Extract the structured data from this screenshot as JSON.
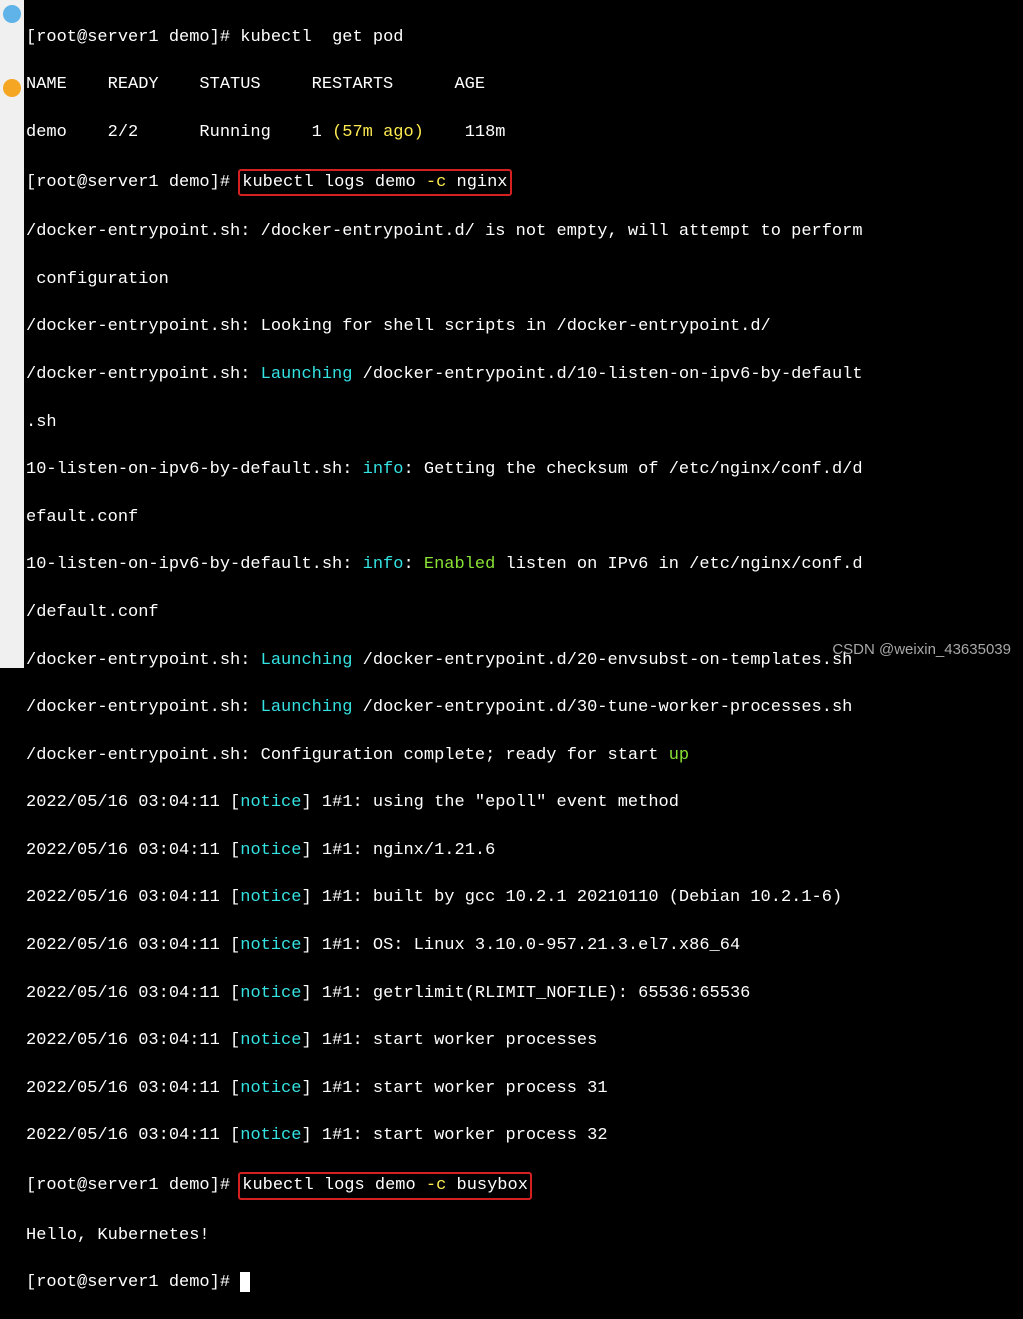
{
  "leftbar": {
    "icons": [
      "plane-icon",
      "orange-icon"
    ]
  },
  "prompts": {
    "p1": "[root@server1 demo]# ",
    "cmd1": "kubectl  get pod",
    "cmd2": "kubectl logs demo ",
    "flag_c": "-c",
    "ctn_nginx": " nginx",
    "ctn_busybox": " busybox"
  },
  "pod_header": "NAME    READY    STATUS     RESTARTS      AGE",
  "pod_row": "demo    2/2      Running    1 ",
  "pod_restart_age": "(57m ago)",
  "pod_age": "    118m",
  "logs": {
    "l1": "/docker-entrypoint.sh: /docker-entrypoint.d/ is not empty, will attempt to perform",
    "l2": " configuration",
    "l3": "/docker-entrypoint.sh: Looking for shell scripts in /docker-entrypoint.d/",
    "l4a": "/docker-entrypoint.sh: ",
    "launching": "Launching",
    "l4b": " /docker-entrypoint.d/10-listen-on-ipv6-by-default",
    "l5": ".sh",
    "l6a": "10-listen-on-ipv6-by-default.sh: ",
    "info": "info",
    "l6b": ": Getting the checksum of /etc/nginx/conf.d/d",
    "l7": "efault.conf",
    "l8b": ": ",
    "enabled": "Enabled",
    "l8c": " listen on IPv6 in /etc/nginx/conf.d",
    "l9": "/default.conf",
    "l10b": " /docker-entrypoint.d/20-envsubst-on-templates.sh",
    "l11b": " /docker-entrypoint.d/30-tune-worker-processes.sh",
    "l12a": "/docker-entrypoint.sh: Configuration complete; ready for start ",
    "up": "up",
    "ts": "2022/05/16 03:04:11 [",
    "notice": "notice",
    "nl1": "] 1#1: using the \"epoll\" event method",
    "nl2": "] 1#1: nginx/1.21.6",
    "nl3": "] 1#1: built by gcc 10.2.1 20210110 (Debian 10.2.1-6)",
    "nl4": "] 1#1: OS: Linux 3.10.0-957.21.3.el7.x86_64",
    "nl5": "] 1#1: getrlimit(RLIMIT_NOFILE): 65536:65536",
    "nl6": "] 1#1: start worker processes",
    "nl7": "] 1#1: start worker process 31",
    "nl8": "] 1#1: start worker process 32",
    "hello": "Hello, Kubernetes!"
  },
  "watermark": "CSDN @weixin_43635039"
}
